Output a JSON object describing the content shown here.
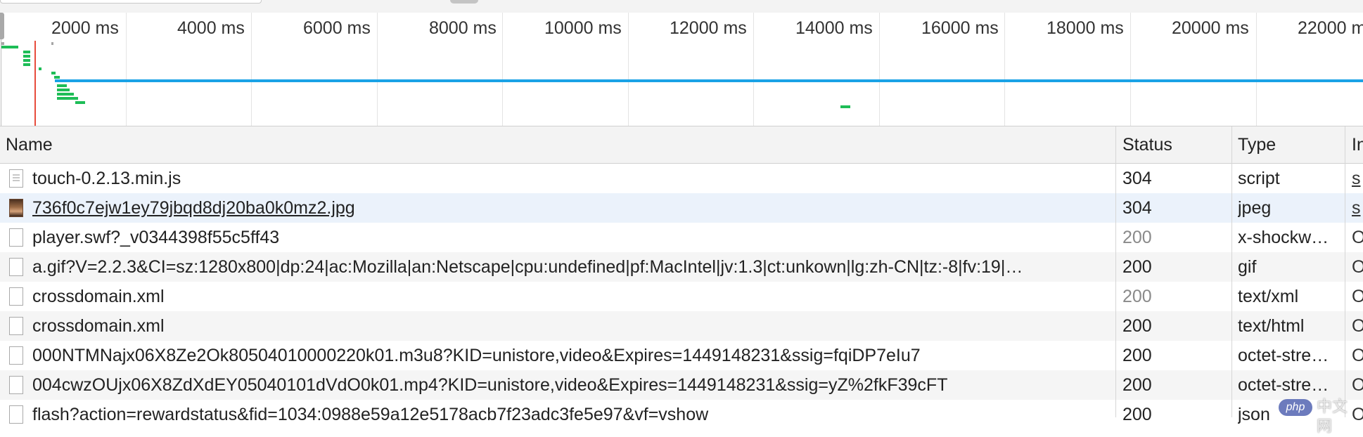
{
  "overview": {
    "ticks": [
      "2000 ms",
      "4000 ms",
      "6000 ms",
      "8000 ms",
      "10000 ms",
      "12000 ms",
      "14000 ms",
      "16000 ms",
      "18000 ms",
      "20000 ms",
      "22000 ms"
    ]
  },
  "columns": {
    "name": "Name",
    "status": "Status",
    "type": "Type",
    "initiator": "In"
  },
  "rows": [
    {
      "name": "touch-0.2.13.min.js",
      "status": "304",
      "type": "script",
      "initiator": "s"
    },
    {
      "name": "736f0c7ejw1ey79jbqd8dj20ba0k0mz2.jpg",
      "status": "304",
      "type": "jpeg",
      "initiator": "s"
    },
    {
      "name": "player.swf?_v0344398f55c5ff43",
      "status": "200",
      "type": "x-shockw…",
      "initiator": "O"
    },
    {
      "name": "a.gif?V=2.2.3&CI=sz:1280x800|dp:24|ac:Mozilla|an:Netscape|cpu:undefined|pf:MacIntel|jv:1.3|ct:unkown|lg:zh-CN|tz:-8|fv:19|…",
      "status": "200",
      "type": "gif",
      "initiator": "O"
    },
    {
      "name": "crossdomain.xml",
      "status": "200",
      "type": "text/xml",
      "initiator": "O"
    },
    {
      "name": "crossdomain.xml",
      "status": "200",
      "type": "text/html",
      "initiator": "O"
    },
    {
      "name": "000NTMNajx06X8Ze2Ok80504010000220k01.m3u8?KID=unistore,video&Expires=1449148231&ssig=fqiDP7eIu7",
      "status": "200",
      "type": "octet-stre…",
      "initiator": "O"
    },
    {
      "name": "004cwzOUjx06X8ZdXdEY05040101dVdO0k01.mp4?KID=unistore,video&Expires=1449148231&ssig=yZ%2fkF39cFT",
      "status": "200",
      "type": "octet-stre…",
      "initiator": "O"
    },
    {
      "name": "flash?action=rewardstatus&fid=1034:0988e59a12e5178acb7f23adc3fe5e97&vf=vshow",
      "status": "200",
      "type": "json",
      "initiator": "O"
    }
  ],
  "watermark": {
    "badge": "php",
    "text": "中文网"
  }
}
